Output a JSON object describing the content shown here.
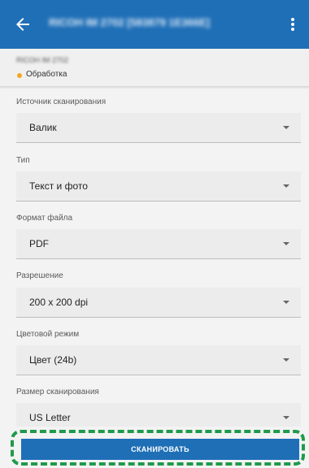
{
  "appbar": {
    "title": "RICOH IM 2702 [583879 1E366E]",
    "icons": {
      "back": "arrow-left-icon",
      "menu": "more-vertical-icon"
    }
  },
  "device": {
    "name": "RICOH IM 2702",
    "status": "Обработка",
    "status_color": "#f5a623"
  },
  "fields": {
    "source": {
      "label": "Источник сканирования",
      "value": "Валик"
    },
    "type": {
      "label": "Тип",
      "value": "Текст и фото"
    },
    "format": {
      "label": "Формат файла",
      "value": "PDF"
    },
    "resolution": {
      "label": "Разрешение",
      "value": "200 x 200 dpi"
    },
    "color_mode": {
      "label": "Цветовой режим",
      "value": "Цвет (24b)"
    },
    "scan_size": {
      "label": "Размер сканирования",
      "value": "US Letter"
    }
  },
  "actions": {
    "scan_label": "СКАНИРОВАТЬ"
  },
  "colors": {
    "primary": "#1f6fb7",
    "highlight": "#1f9a4a"
  }
}
